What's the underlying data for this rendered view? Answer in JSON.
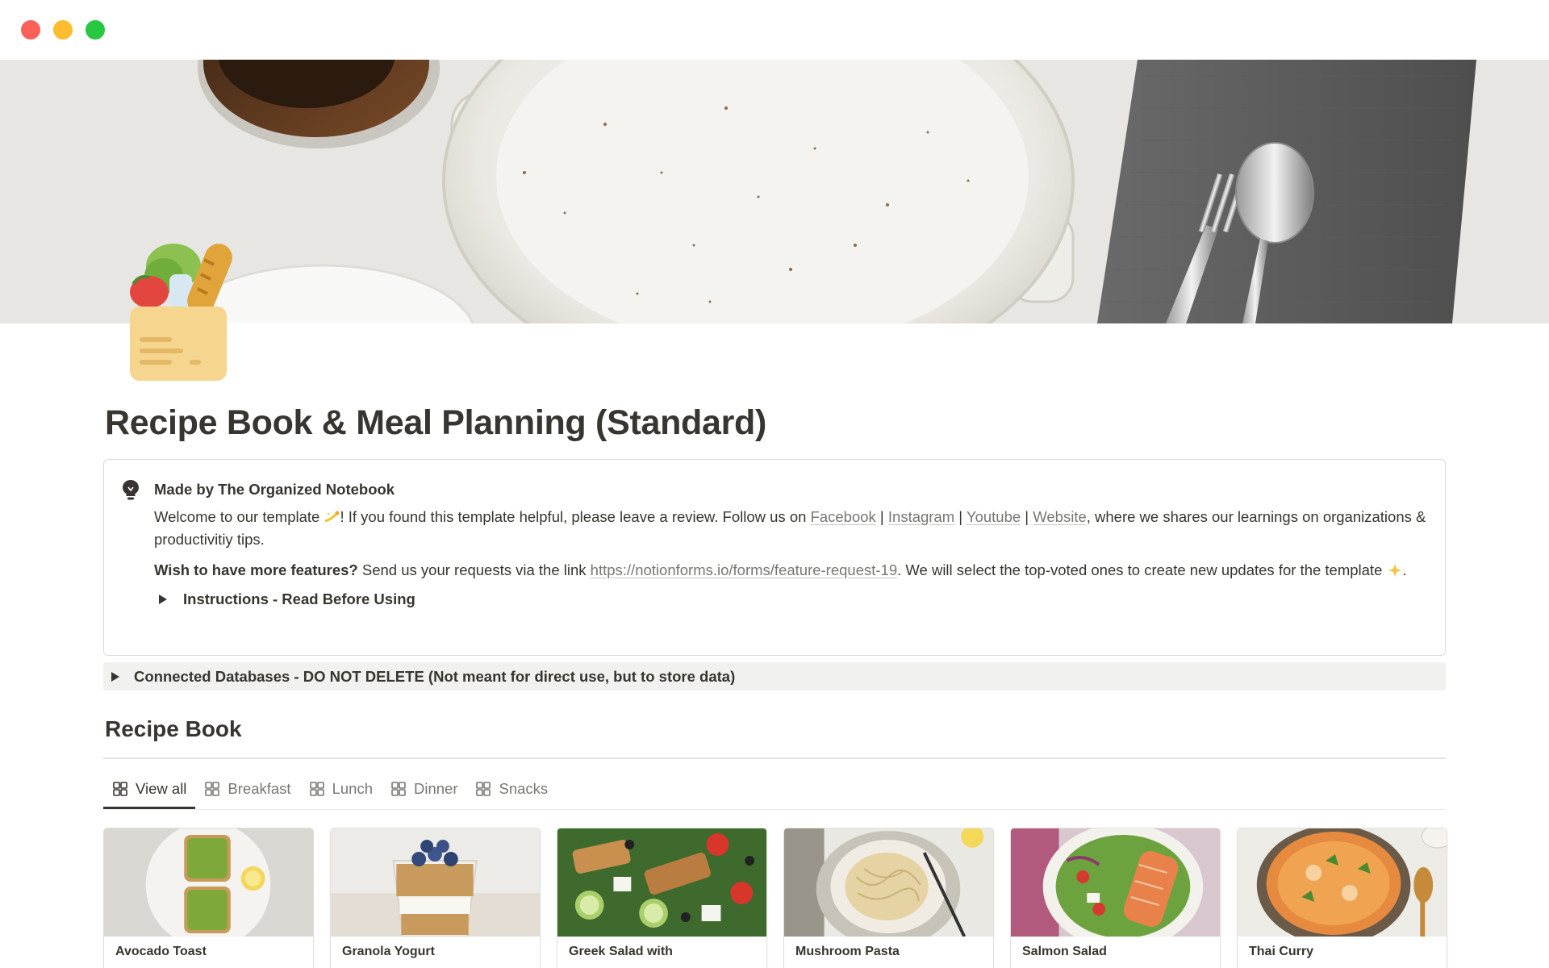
{
  "window": {
    "controls": [
      "close",
      "minimize",
      "zoom"
    ]
  },
  "page": {
    "title": "Recipe Book & Meal Planning (Standard)",
    "icon": "grocery-bag-icon"
  },
  "callout": {
    "icon": "lightbulb-icon",
    "heading": "Made by The Organized Notebook",
    "welcome_prefix": "Welcome to our template",
    "welcome_mid": "!  If you found this template helpful, please leave a review. Follow us on ",
    "links": {
      "facebook": "Facebook",
      "instagram": "Instagram",
      "youtube": "Youtube",
      "website": "Website"
    },
    "separator": " | ",
    "welcome_suffix": ", where we shares our learnings on organizations & productivitiy tips.",
    "features_bold": "Wish to have more features?",
    "features_text": " Send us your requests via the link ",
    "features_link": "https://notionforms.io/forms/feature-request-19",
    "features_suffix": ". We will select the top-voted ones to create new updates for the template",
    "features_end": ".",
    "toggle_label": "Instructions - Read Before Using"
  },
  "connected_toggle": {
    "label": "Connected Databases - DO NOT DELETE (Not meant for direct use, but to store data)"
  },
  "recipe_book": {
    "heading": "Recipe Book",
    "tabs": [
      {
        "label": "View all",
        "active": true
      },
      {
        "label": "Breakfast",
        "active": false
      },
      {
        "label": "Lunch",
        "active": false
      },
      {
        "label": "Dinner",
        "active": false
      },
      {
        "label": "Snacks",
        "active": false
      }
    ],
    "cards": [
      {
        "title": "Avocado Toast",
        "image": "avocado-toast-image"
      },
      {
        "title": "Granola Yogurt",
        "image": "granola-yogurt-image"
      },
      {
        "title": "Greek Salad with",
        "image": "greek-salad-image"
      },
      {
        "title": "Mushroom Pasta",
        "image": "pasta-image"
      },
      {
        "title": "Salmon Salad",
        "image": "salmon-salad-image"
      },
      {
        "title": "Thai Curry",
        "image": "thai-curry-image"
      }
    ]
  },
  "colors": {
    "text": "#37352f",
    "muted": "#787774",
    "callout_border": "#dcdbd8",
    "toggle_bg": "#f1f1ef"
  }
}
